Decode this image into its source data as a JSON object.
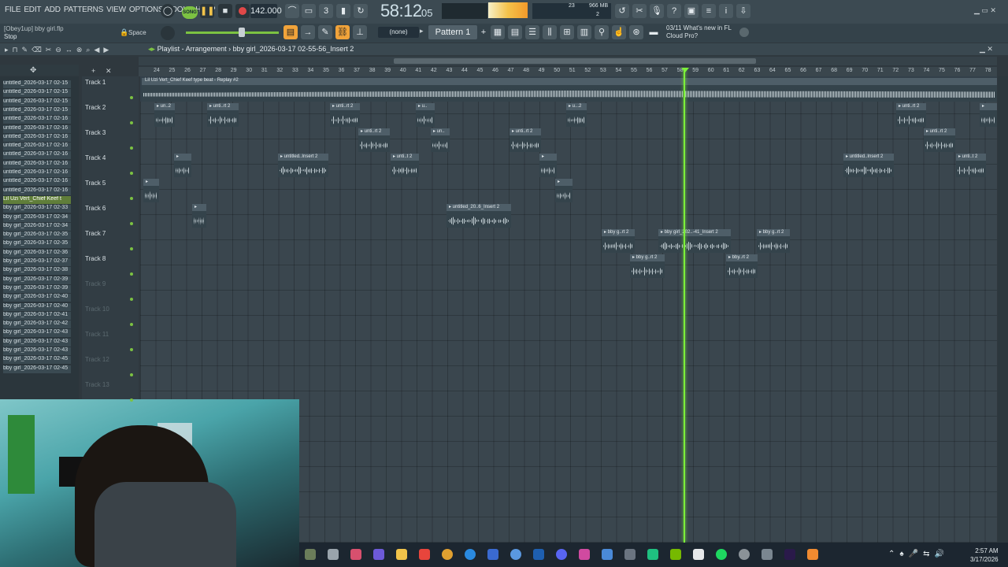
{
  "menu": [
    "FILE",
    "EDIT",
    "ADD",
    "PATTERNS",
    "VIEW",
    "OPTIONS",
    "TOOLS",
    "HELP"
  ],
  "transport": {
    "song_label": "SONG",
    "tempo": "142.000",
    "time": "58:12",
    "time_sub": "05"
  },
  "cpu": {
    "mem": "966 MB",
    "voices": "23",
    "poly": "2"
  },
  "hint": {
    "project": "[Obey1up] bby girl.flp",
    "status": "Stop",
    "key": "Space"
  },
  "pattern": {
    "none_label": "(none)",
    "selected": "Pattern 1"
  },
  "news": {
    "date": "03/11",
    "line1": "What's new in FL",
    "line2": "Cloud Pro?"
  },
  "playlist": {
    "title": "Playlist - Arrangement",
    "breadcrumb": "bby girl_2026-03-17 02-55-56_Insert 2"
  },
  "ruler": [
    "24",
    "25",
    "26",
    "27",
    "28",
    "29",
    "30",
    "31",
    "32",
    "33",
    "34",
    "35",
    "36",
    "37",
    "38",
    "39",
    "40",
    "41",
    "42",
    "43",
    "44",
    "45",
    "46",
    "47",
    "48",
    "49",
    "50",
    "51",
    "52",
    "53",
    "54",
    "55",
    "56",
    "57",
    "58",
    "59",
    "60",
    "61",
    "62",
    "63",
    "64",
    "65",
    "66",
    "67",
    "68",
    "69",
    "70",
    "71",
    "72",
    "73",
    "74",
    "75",
    "76",
    "77",
    "78"
  ],
  "browser": [
    "untitled_2026-03-17 02-15",
    "untitled_2026-03-17 02-15",
    "untitled_2026-03-17 02-15",
    "untitled_2026-03-17 02-15",
    "untitled_2026-03-17 02-16",
    "untitled_2026-03-17 02-16",
    "untitled_2026-03-17 02-16",
    "untitled_2026-03-17 02-16",
    "untitled_2026-03-17 02-16",
    "untitled_2026-03-17 02-16",
    "untitled_2026-03-17 02-16",
    "untitled_2026-03-17 02-16",
    "untitled_2026-03-17 02-16",
    "Lil Uzi Vert_Chief Keef t",
    "bby girl_2026-03-17 02-33",
    "bby girl_2026-03-17 02-34",
    "bby girl_2026-03-17 02-34",
    "bby girl_2026-03-17 02-35",
    "bby girl_2026-03-17 02-35",
    "bby girl_2026-03-17 02-36",
    "bby girl_2026-03-17 02-37",
    "bby girl_2026-03-17 02-38",
    "bby girl_2026-03-17 02-39",
    "bby girl_2026-03-17 02-39",
    "bby girl_2026-03-17 02-40",
    "bby girl_2026-03-17 02-40",
    "bby girl_2026-03-17 02-41",
    "bby girl_2026-03-17 02-42",
    "bby girl_2026-03-17 02-43",
    "bby girl_2026-03-17 02-43",
    "bby girl_2026-03-17 02-43",
    "bby girl_2026-03-17 02-45",
    "bby girl_2026-03-17 02-45"
  ],
  "tracks": [
    "Track 1",
    "Track 2",
    "Track 3",
    "Track 4",
    "Track 5",
    "Track 6",
    "Track 7",
    "Track 8",
    "Track 9",
    "Track 10",
    "Track 11",
    "Track 12",
    "Track 13"
  ],
  "clips": {
    "t1": "Lil Uzi Vert_Chief Keef type beat - Replay #2",
    "c2a": "un..2",
    "c2b": "unti..rt 2",
    "c2c": "unti..rt 2",
    "c2d": "u..",
    "c2e": "u...2",
    "c2f": "unti..rt 2",
    "c3a": "unti..rt 2",
    "c3b": "un..",
    "c3c": "unti..rt 2",
    "c3d": "unti..rt 2",
    "c4a": "",
    "c4b": "untitled..Insert 2",
    "c4c": "unti..t 2",
    "c4d": "",
    "c4e": "untitled..Insert 2",
    "c4f": "unti..t 2",
    "c5a": "",
    "c5b": "",
    "c6a": "",
    "c6b": "untitled_20..6_Insert 2",
    "c7a": "bby g..rt 2",
    "c7b": "bby girl_202..-41_Insert 2",
    "c7c": "bby g..rt 2",
    "c8a": "bby g..rt 2",
    "c8b": "bby..rt 2"
  },
  "taskbar_clock": {
    "time": "2:57 AM",
    "date": "3/17/2026"
  }
}
